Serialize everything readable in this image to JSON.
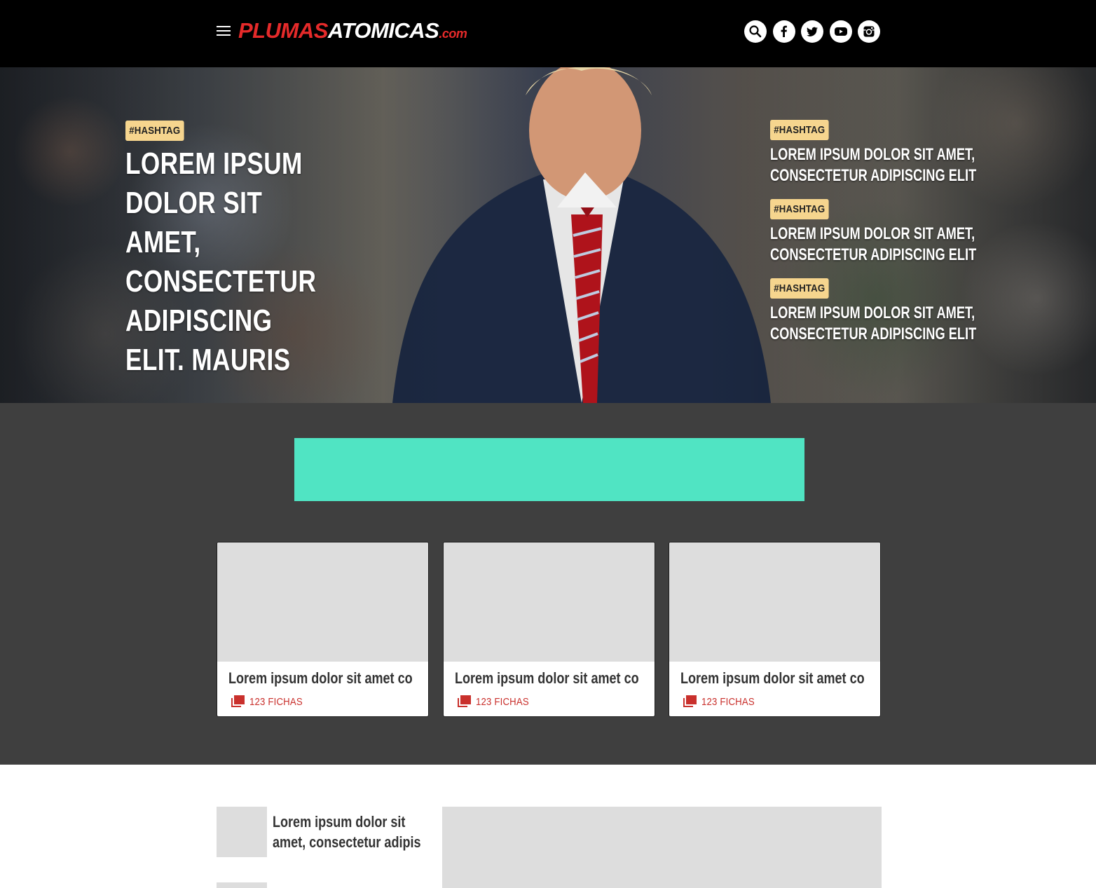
{
  "header": {
    "logo": {
      "part1": "PLUMAS",
      "part2": "ATOMICAS",
      "domain": ".com"
    },
    "social": [
      "search-icon",
      "facebook-icon",
      "twitter-icon",
      "youtube-icon",
      "instagram-icon"
    ]
  },
  "hero": {
    "main": {
      "tag": "#HASHTAG",
      "headline": "LOREM IPSUM DOLOR SIT AMET, CONSECTETUR ADIPISCING ELIT. MAURIS"
    },
    "side": [
      {
        "tag": "#HASHTAG",
        "headline": "LOREM IPSUM DOLOR SIT AMET, CONSECTETUR ADIPISCING ELIT"
      },
      {
        "tag": "#HASHTAG",
        "headline": "LOREM IPSUM DOLOR SIT AMET, CONSECTETUR ADIPISCING ELIT"
      },
      {
        "tag": "#HASHTAG",
        "headline": "LOREM IPSUM DOLOR SIT AMET, CONSECTETUR ADIPISCING ELIT"
      }
    ]
  },
  "colors": {
    "header_bg": "#000000",
    "brand_red": "#e52a2a",
    "tag_bg": "#f6d58e",
    "dark_section": "#3f3f3f",
    "ad_banner": "#50e4c3",
    "placeholder": "#dddddd",
    "meta_red": "#c9302c"
  },
  "cards": [
    {
      "title": "Lorem ipsum dolor sit amet co",
      "meta": "123 FICHAS"
    },
    {
      "title": "Lorem ipsum dolor sit amet co",
      "meta": "123 FICHAS"
    },
    {
      "title": "Lorem ipsum dolor sit amet co",
      "meta": "123 FICHAS"
    }
  ],
  "list": [
    {
      "title": "Lorem ipsum dolor sit amet, consectetur adipis"
    }
  ]
}
